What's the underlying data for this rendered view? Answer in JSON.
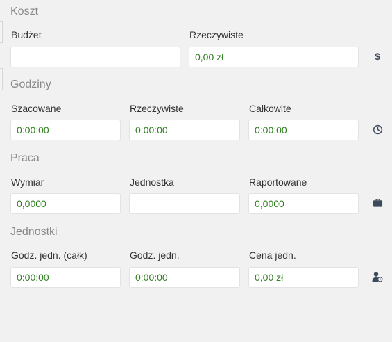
{
  "sections": {
    "cost": {
      "title": "Koszt",
      "budget_label": "Budżet",
      "budget_value": "",
      "actual_label": "Rzeczywiste",
      "actual_value": "0,00 zł",
      "icon": "dollar-icon"
    },
    "hours": {
      "title": "Godziny",
      "estimated_label": "Szacowane",
      "estimated_value": "0:00:00",
      "actual_label": "Rzeczywiste",
      "actual_value": "0:00:00",
      "total_label": "Całkowite",
      "total_value": "0:00:00",
      "icon": "clock-icon"
    },
    "work": {
      "title": "Praca",
      "dimension_label": "Wymiar",
      "dimension_value": "0,0000",
      "unit_label": "Jednostka",
      "unit_value": "",
      "reported_label": "Raportowane",
      "reported_value": "0,0000",
      "icon": "briefcase-icon"
    },
    "units": {
      "title": "Jednostki",
      "unit_hours_total_label": "Godz. jedn. (całk)",
      "unit_hours_total_value": "0:00:00",
      "unit_hours_label": "Godz. jedn.",
      "unit_hours_value": "0:00:00",
      "unit_price_label": "Cena jedn.",
      "unit_price_value": "0,00 zł",
      "icon": "user-clock-icon"
    }
  },
  "colors": {
    "background": "#f1f1f1",
    "value_text": "#2e7d1e",
    "section_title": "#888888",
    "icon": "#3d4a5c"
  }
}
